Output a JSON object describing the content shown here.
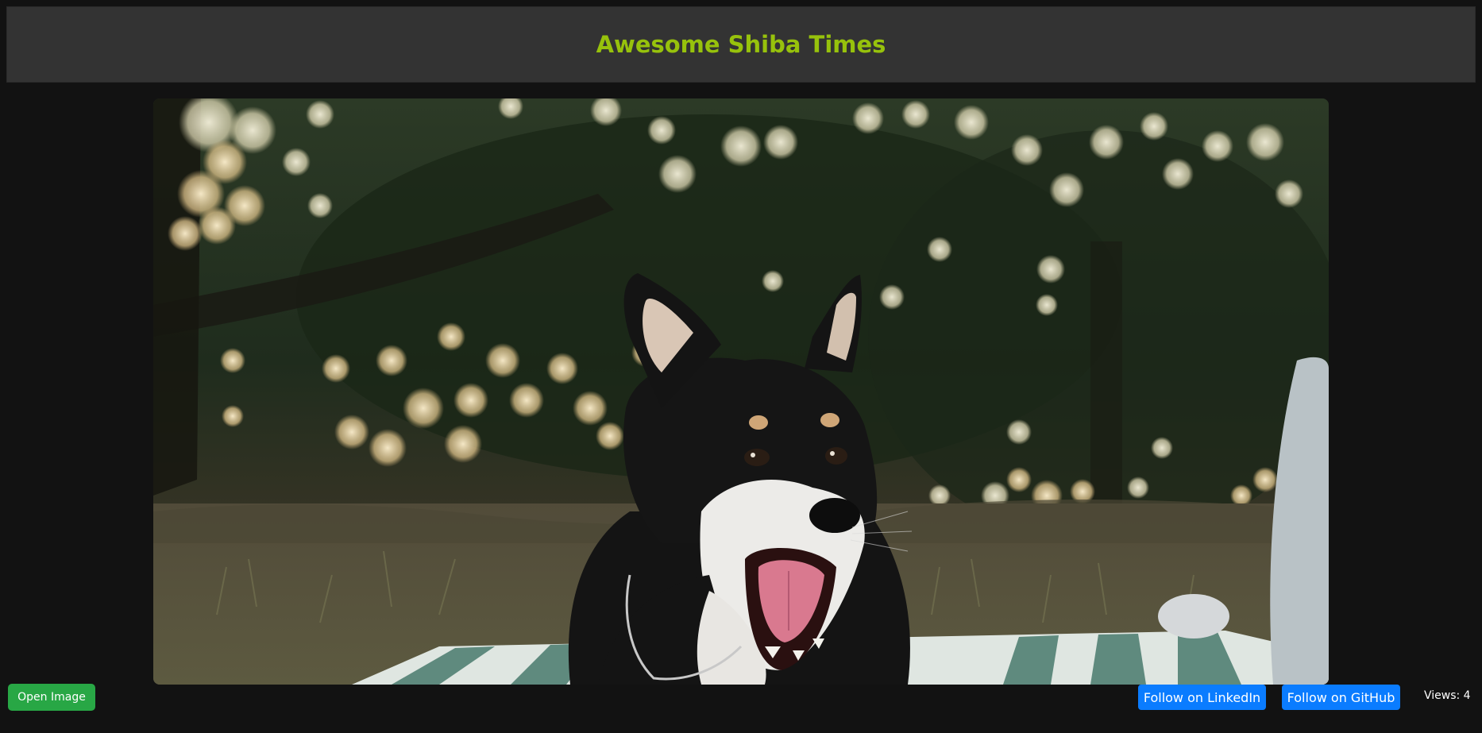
{
  "header": {
    "title": "Awesome Shiba Times",
    "title_color": "#97c20c",
    "background": "#333333"
  },
  "main": {
    "image_subject": "shiba-inu-dog-photo"
  },
  "footer": {
    "open_image_label": "Open Image",
    "linkedin_label": "Follow on LinkedIn",
    "github_label": "Follow on GitHub",
    "views_label": "Views: 4"
  },
  "colors": {
    "page_bg": "#121212",
    "open_button": "#28a745",
    "follow_button": "#0a7cff"
  }
}
